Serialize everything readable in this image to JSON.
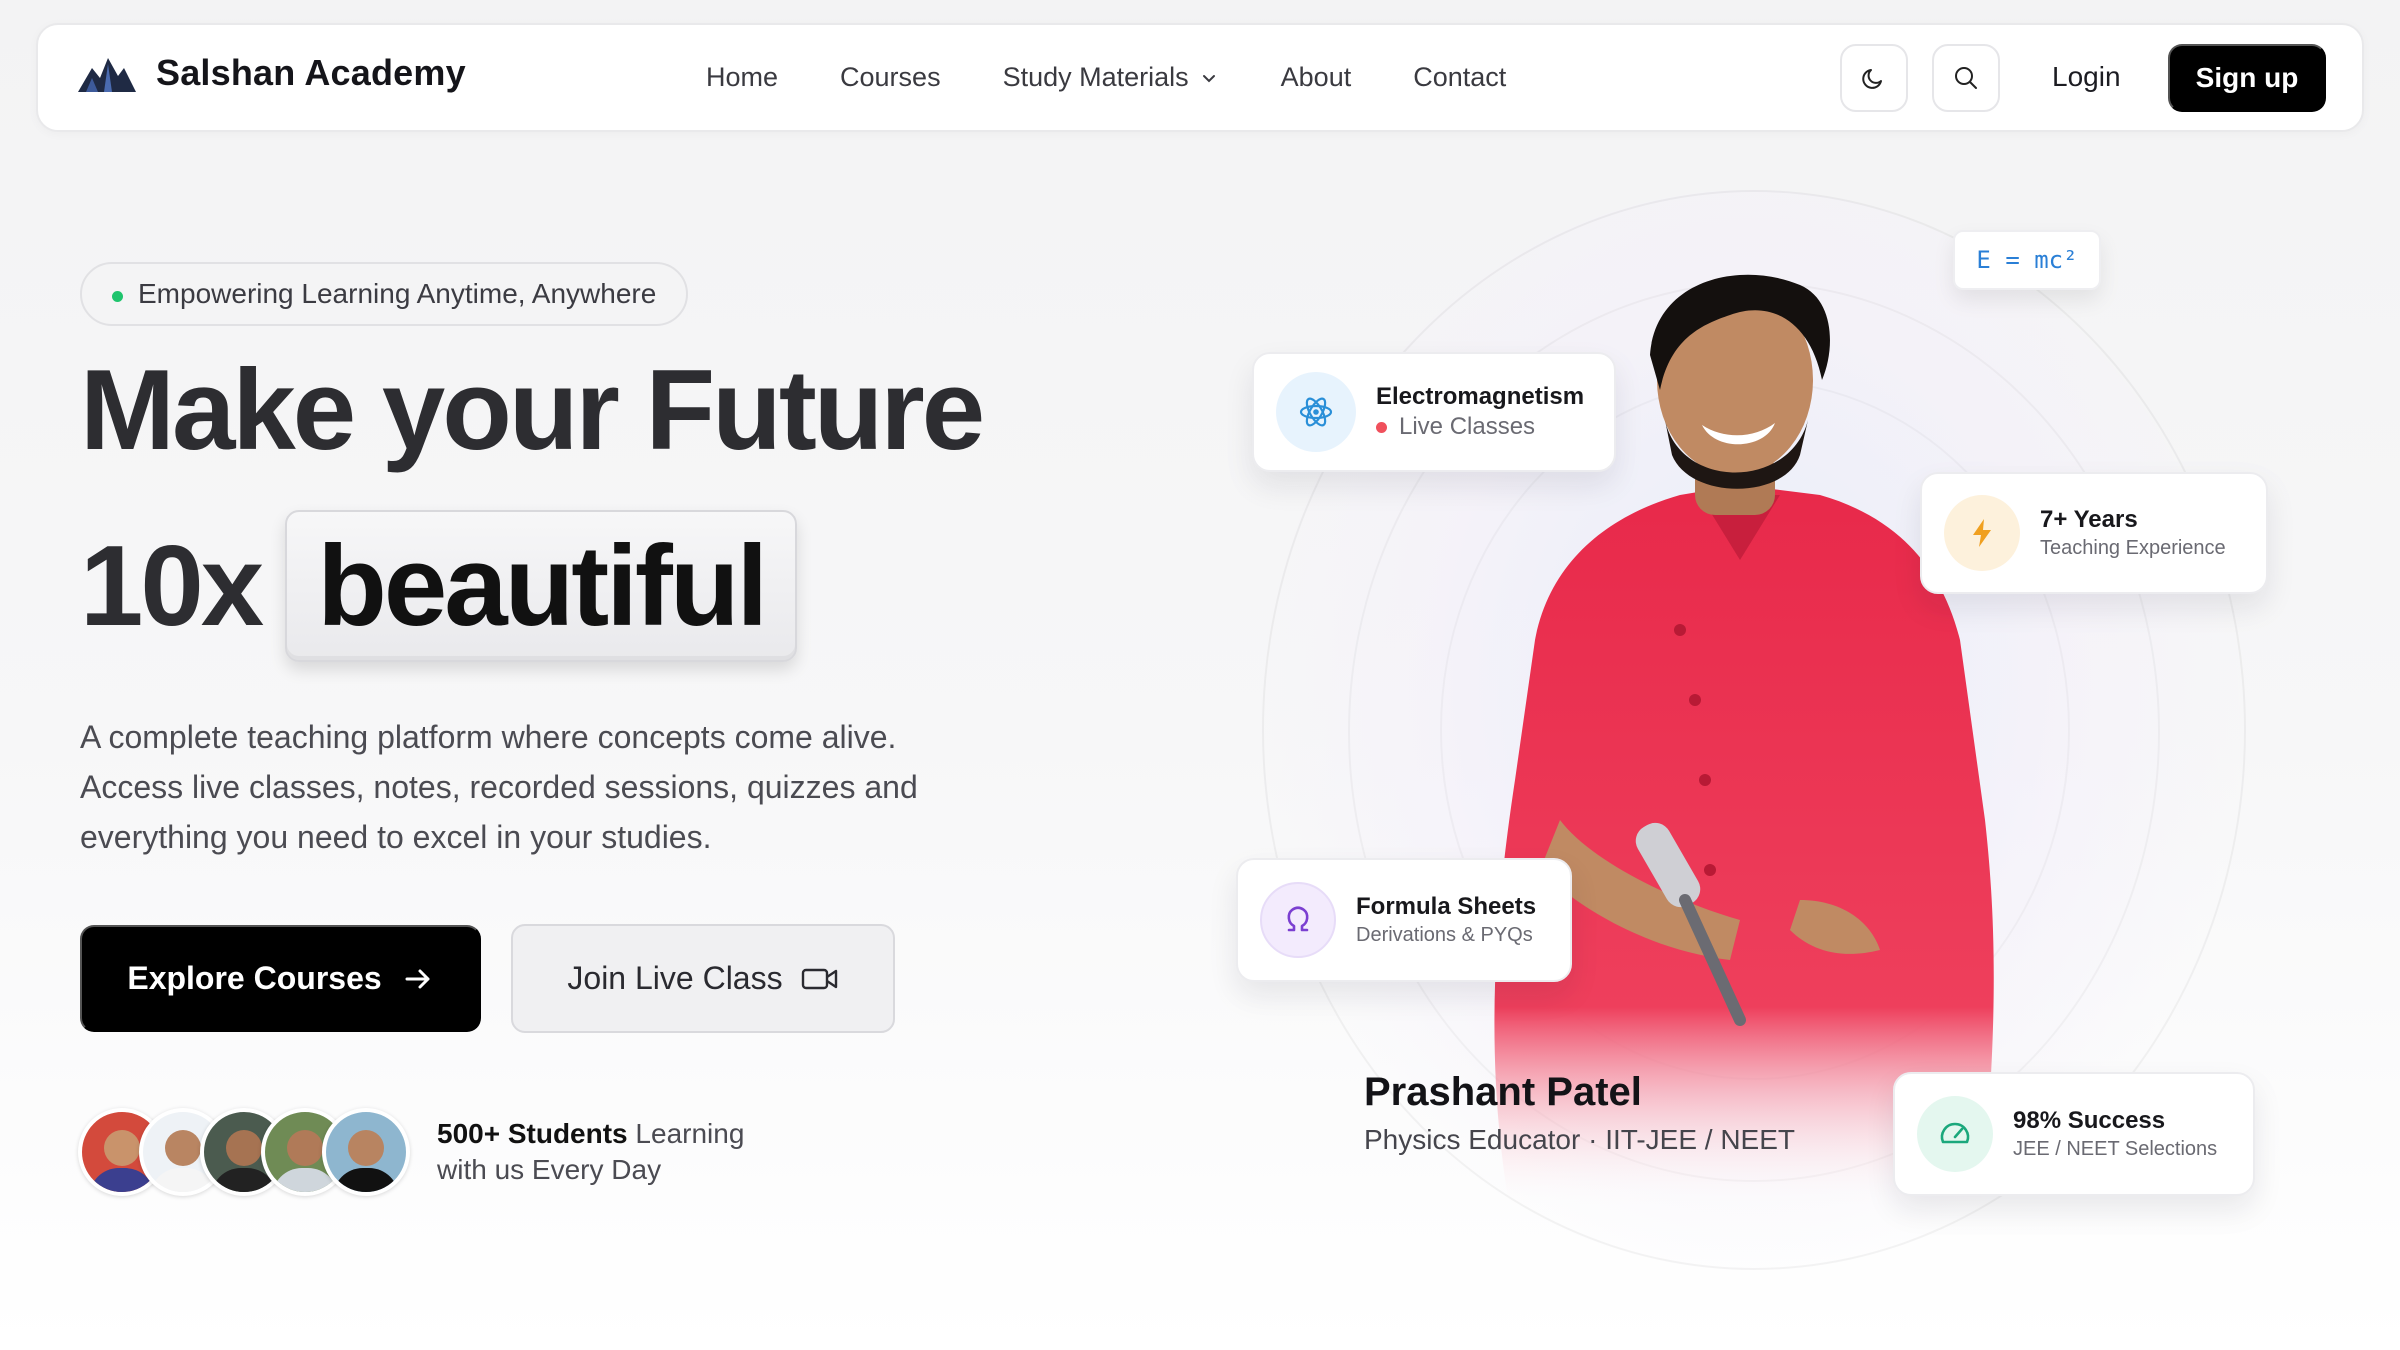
{
  "brand": {
    "name": "Salshan Academy"
  },
  "nav": {
    "links": [
      "Home",
      "Courses",
      "Study Materials",
      "About",
      "Contact"
    ],
    "login": "Login",
    "signup": "Sign up"
  },
  "hero": {
    "badge": "Empowering Learning Anytime, Anywhere",
    "headline_line1": "Make your Future",
    "headline_prefix": "10x",
    "headline_highlight": "beautiful",
    "description": "A complete teaching platform where concepts come alive. Access live classes, notes, recorded sessions, quizzes and everything you need to excel in your studies.",
    "primary_cta": "Explore Courses",
    "secondary_cta": "Join Live Class",
    "students_bold": "500+ Students",
    "students_rest1": " Learning",
    "students_rest2": "with us Every Day"
  },
  "instructor": {
    "name": "Prashant Patel",
    "role": "Physics Educator · IIT-JEE / NEET"
  },
  "cards": {
    "formula_chip": "E = mc²",
    "electro_title": "Electromagnetism",
    "electro_sub": "Live Classes",
    "experience_title": "7+ Years",
    "experience_sub": "Teaching Experience",
    "formula_title": "Formula Sheets",
    "formula_sub": "Derivations & PYQs",
    "success_title": "98% Success",
    "success_sub": "JEE / NEET Selections"
  },
  "colors": {
    "accent": "#000000",
    "live_dot": "#f0505c",
    "badge_dot": "#1fc46d",
    "atom_blue": "#2a8fd8",
    "bolt_orange": "#f0a020",
    "omega_purple": "#7b3fd1",
    "success_green": "#1ba87c",
    "shirt_red": "#e8294a"
  },
  "icons": [
    "logo-mountain-icon",
    "chevron-down-icon",
    "moon-icon",
    "search-icon",
    "arrow-right-icon",
    "video-icon",
    "atom-icon",
    "bolt-icon",
    "omega-icon",
    "gauge-icon"
  ]
}
